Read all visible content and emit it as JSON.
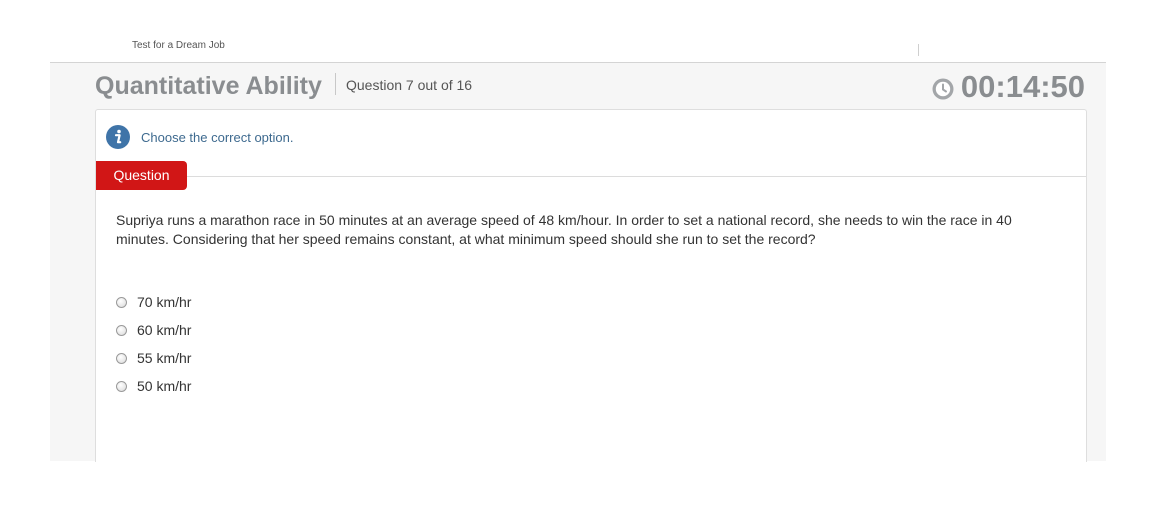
{
  "top_strip": {
    "cut_text": "Test for a Dream Job"
  },
  "header": {
    "title": "Quantitative Ability",
    "question_count": "Question 7 out of 16",
    "timer": "00:14:50"
  },
  "instruction": {
    "text": "Choose the correct option."
  },
  "question_tab": {
    "label": "Question"
  },
  "question": {
    "text": "Supriya runs a marathon race in 50 minutes at an average speed of 48 km/hour. In order to set a national record, she needs to win the race in 40 minutes. Considering that her speed remains constant, at what minimum speed should she run to set the record?"
  },
  "options": [
    {
      "label": "70 km/hr"
    },
    {
      "label": "60 km/hr"
    },
    {
      "label": "55 km/hr"
    },
    {
      "label": "50 km/hr"
    }
  ],
  "colors": {
    "tab_red": "#d11616",
    "info_blue": "#3e6a8f",
    "header_grey": "#8a8d90"
  }
}
